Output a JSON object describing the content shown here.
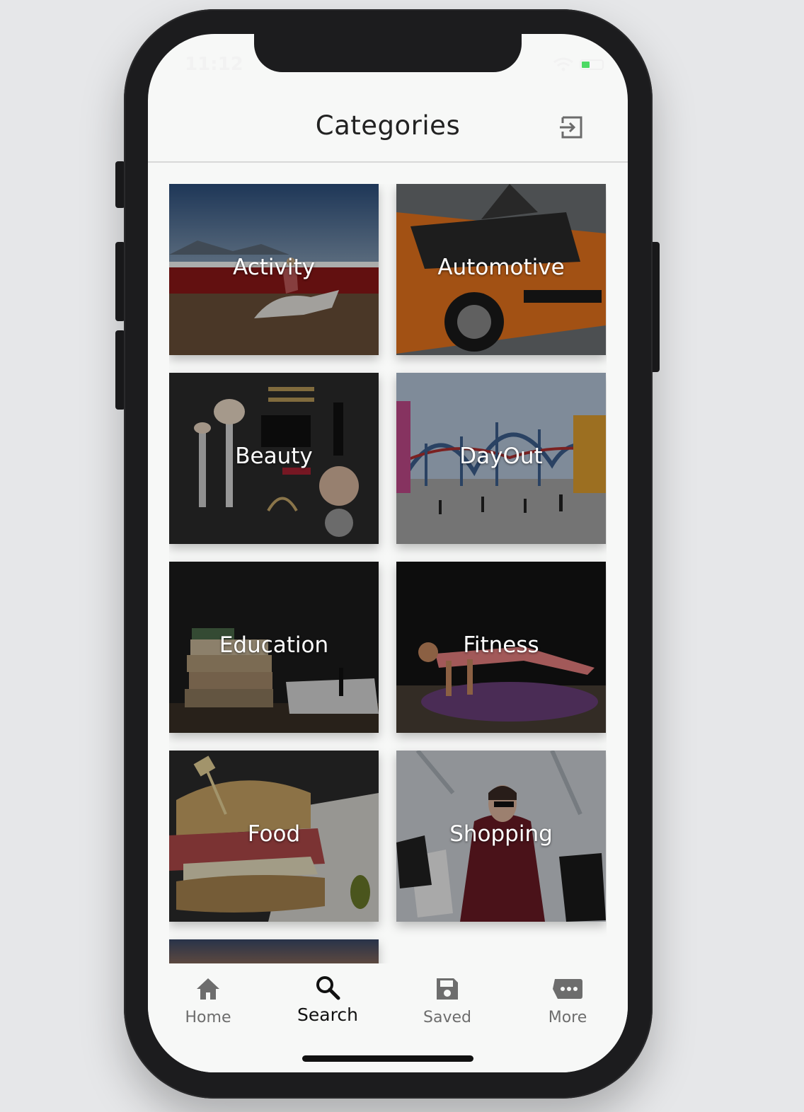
{
  "status_bar": {
    "time": "11:12",
    "battery_color": "#4cd964"
  },
  "header": {
    "title": "Categories",
    "logout_icon": "logout-icon"
  },
  "categories": [
    {
      "label": "Activity",
      "image": "horse rider on dirt arena"
    },
    {
      "label": "Automotive",
      "image": "orange muscle car with open hood"
    },
    {
      "label": "Beauty",
      "image": "makeup brushes and cosmetics"
    },
    {
      "label": "DayOut",
      "image": "roller coaster theme park"
    },
    {
      "label": "Education",
      "image": "stack of books with notebook"
    },
    {
      "label": "Fitness",
      "image": "woman doing push-up on mat"
    },
    {
      "label": "Food",
      "image": "sandwich with pickles"
    },
    {
      "label": "Shopping",
      "image": "woman with shopping bags"
    }
  ],
  "tabbar": {
    "items": [
      {
        "label": "Home",
        "icon": "home-icon"
      },
      {
        "label": "Search",
        "icon": "search-icon",
        "active": true
      },
      {
        "label": "Saved",
        "icon": "save-icon"
      },
      {
        "label": "More",
        "icon": "more-icon"
      }
    ]
  }
}
